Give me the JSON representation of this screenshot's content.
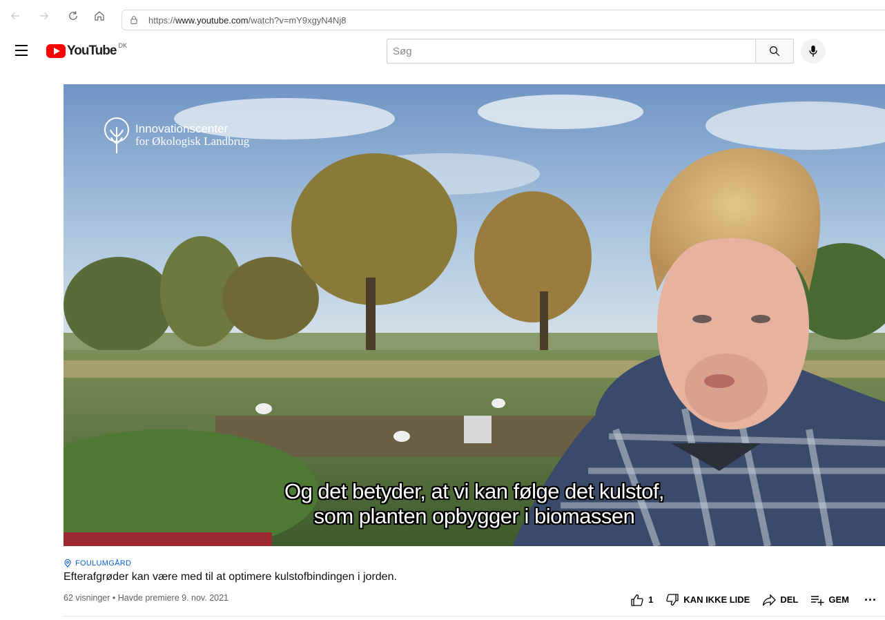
{
  "browser": {
    "url_prefix": "https://",
    "url_host": "www.youtube.com",
    "url_path": "/watch?v=mY9xgyN4Nj8"
  },
  "masthead": {
    "logo_text": "YouTube",
    "region": "DK",
    "search_placeholder": "Søg"
  },
  "player": {
    "brand_line1": "Innovationscenter",
    "brand_line2": "for Økologisk Landbrug",
    "subtitle_line1": "Og det betyder, at vi kan følge det kulstof,",
    "subtitle_line2": "som planten opbygger i biomassen",
    "progress_fraction": 0.254,
    "progress_color": "#9b2a30"
  },
  "video": {
    "location": "FOULUMGÅRD",
    "title": "Efterafgrøder kan være med til at optimere kulstofbindingen i jorden.",
    "meta": "62 visninger • Havde premiere 9. nov. 2021"
  },
  "actions": {
    "like_count": "1",
    "dislike_label": "KAN IKKE LIDE",
    "share_label": "DEL",
    "save_label": "GEM",
    "more_label": "..."
  },
  "icons": [
    "back-icon",
    "forward-icon",
    "reload-icon",
    "home-icon",
    "lock-icon",
    "menu-icon",
    "youtube-logo-icon",
    "search-icon",
    "mic-icon",
    "location-pin-icon",
    "thumbs-up-icon",
    "thumbs-down-icon",
    "share-icon",
    "playlist-add-icon",
    "more-icon"
  ],
  "colors": {
    "youtube_red": "#ff0000",
    "link_blue": "#065fd4"
  }
}
